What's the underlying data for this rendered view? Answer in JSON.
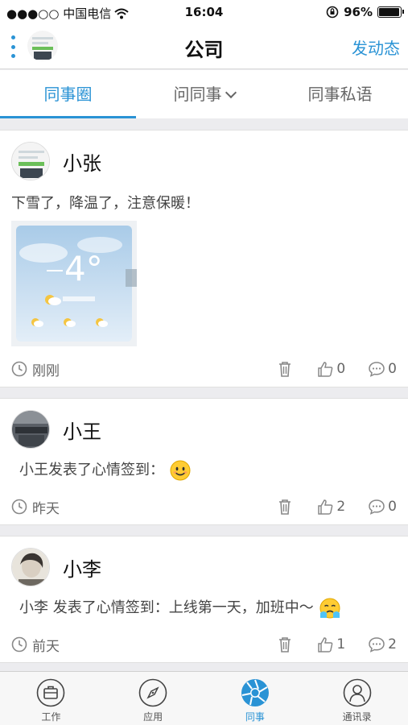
{
  "status": {
    "carrier": "●●●○○ 中国电信",
    "time": "16:04",
    "battery": "96%",
    "battery_level": 0.96
  },
  "nav": {
    "title": "公司",
    "action": "发动态"
  },
  "tabs": [
    {
      "label": "同事圈",
      "active": true
    },
    {
      "label": "问同事",
      "active": false
    },
    {
      "label": "同事私语",
      "active": false
    }
  ],
  "posts": [
    {
      "name": "小张",
      "content": "下雪了，降温了，注意保暖！",
      "time": "刚刚",
      "likes": "0",
      "comments": "0"
    },
    {
      "name": "小王",
      "content": "小王发表了心情签到：",
      "time": "昨天",
      "likes": "2",
      "comments": "0"
    },
    {
      "name": "小李",
      "content": "小李  发表了心情签到：上线第一天，加班中～",
      "time": "前天",
      "likes": "1",
      "comments": "2"
    }
  ],
  "tabbar": [
    {
      "label": "工作",
      "icon": "briefcase-icon"
    },
    {
      "label": "应用",
      "icon": "compass-icon"
    },
    {
      "label": "同事",
      "icon": "aperture-icon",
      "active": true
    },
    {
      "label": "通讯录",
      "icon": "contacts-icon"
    }
  ],
  "colors": {
    "accent": "#2a93d5",
    "background": "#ececef"
  }
}
